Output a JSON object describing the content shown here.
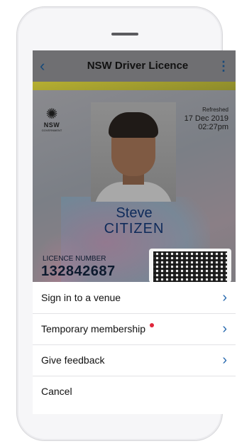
{
  "header": {
    "title": "NSW Driver Licence",
    "back_icon": "chevron-left-icon",
    "menu_icon": "kebab-icon"
  },
  "card": {
    "logo_text": "NSW",
    "logo_subtext": "GOVERNMENT",
    "refresh_label": "Refreshed",
    "refresh_date": "17 Dec 2019",
    "refresh_time": "02:27pm",
    "first_name": "Steve",
    "last_name": "CITIZEN",
    "licence_label": "LICENCE NUMBER",
    "licence_number": "132842687"
  },
  "sheet": {
    "items": [
      {
        "label": "Sign in to a venue"
      },
      {
        "label": "Temporary membership"
      },
      {
        "label": "Give feedback"
      },
      {
        "label": "Cancel"
      }
    ],
    "chevron": "›",
    "badge_color": "#e0263a"
  },
  "colors": {
    "accent": "#2b6cb0",
    "name_color": "#0e2a5a"
  }
}
